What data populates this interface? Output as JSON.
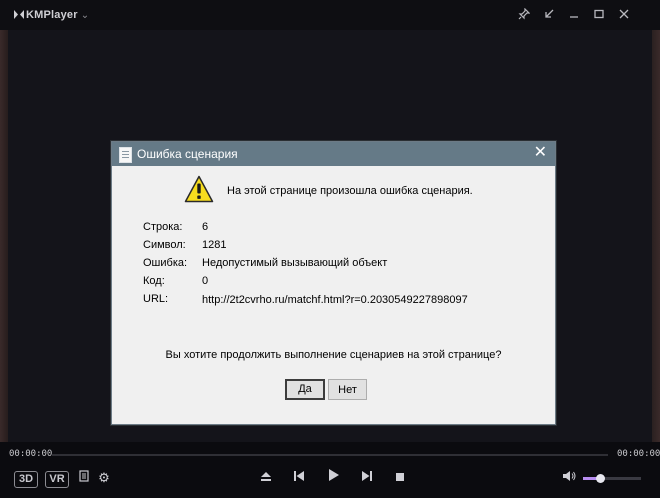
{
  "app": {
    "title": "KMPlayer",
    "icons": [
      "pin-icon",
      "shrink-icon",
      "minimize-icon",
      "maximize-icon",
      "close-icon"
    ]
  },
  "dialog": {
    "title": "Ошибка сценария",
    "message": "На этой странице произошла ошибка сценария.",
    "fields": [
      {
        "label": "Строка:",
        "value": "6"
      },
      {
        "label": "Символ:",
        "value": "1281"
      },
      {
        "label": "Ошибка:",
        "value": "Недопустимый вызывающий объект"
      },
      {
        "label": "Код:",
        "value": "0"
      },
      {
        "label": "URL:",
        "value": "http://2t2cvrho.ru/matchf.html?r=0.2030549227898097"
      }
    ],
    "question": "Вы хотите продолжить выполнение сценариев на этой странице?",
    "yes_label": "Да",
    "no_label": "Нет"
  },
  "player": {
    "time_current": "00:00:00",
    "time_total": "00:00:00",
    "badge_3d": "3D",
    "badge_vr": "VR",
    "volume_level": 0.3,
    "accent_color": "#b78df0"
  }
}
